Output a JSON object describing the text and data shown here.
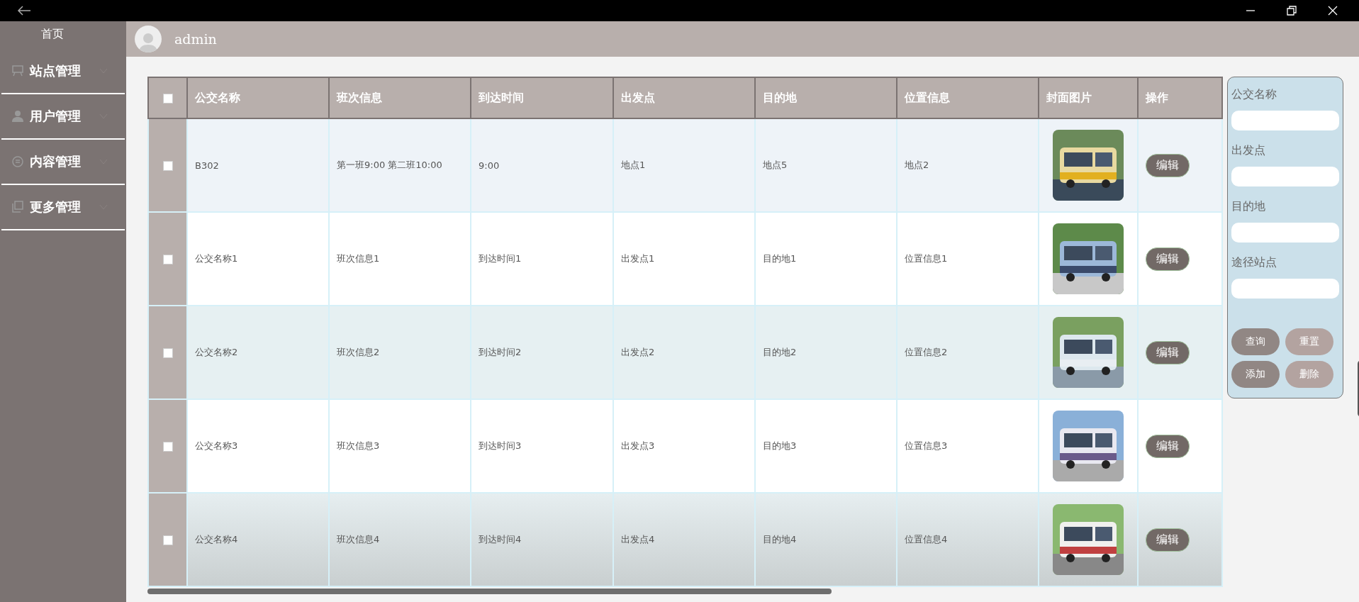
{
  "sidebar": {
    "home": "首页",
    "items": [
      {
        "label": "站点管理",
        "expanded": false
      },
      {
        "label": "用户管理",
        "expanded": false
      },
      {
        "label": "内容管理",
        "expanded": false
      },
      {
        "label": "更多管理",
        "expanded": false
      }
    ]
  },
  "header": {
    "username": "admin"
  },
  "table": {
    "select_all_checked": false,
    "columns": [
      "公交名称",
      "班次信息",
      "到达时间",
      "出发点",
      "目的地",
      "位置信息",
      "封面图片",
      "操作"
    ],
    "rows": [
      {
        "checked": false,
        "cells": [
          "B302",
          "第一班9:00 第二班10:00",
          "9:00",
          "地点1",
          "地点5",
          "地点2"
        ],
        "action": "编辑"
      },
      {
        "checked": false,
        "cells": [
          "公交名称1",
          "班次信息1",
          "到达时间1",
          "出发点1",
          "目的地1",
          "位置信息1"
        ],
        "action": "编辑"
      },
      {
        "checked": false,
        "cells": [
          "公交名称2",
          "班次信息2",
          "到达时间2",
          "出发点2",
          "目的地2",
          "位置信息2"
        ],
        "action": "编辑"
      },
      {
        "checked": false,
        "cells": [
          "公交名称3",
          "班次信息3",
          "到达时间3",
          "出发点3",
          "目的地3",
          "位置信息3"
        ],
        "action": "编辑"
      },
      {
        "checked": false,
        "cells": [
          "公交名称4",
          "班次信息4",
          "到达时间4",
          "出发点4",
          "目的地4",
          "位置信息4"
        ],
        "action": "编辑"
      }
    ]
  },
  "search_panel": {
    "fields": [
      {
        "label": "公交名称"
      },
      {
        "label": "出发点"
      },
      {
        "label": "目的地"
      },
      {
        "label": "途径站点"
      }
    ],
    "buttons": [
      {
        "label": "查询",
        "kind": "dark"
      },
      {
        "label": "重置",
        "kind": "light"
      },
      {
        "label": "添加",
        "kind": "dark"
      },
      {
        "label": "删除",
        "kind": "light"
      }
    ]
  }
}
